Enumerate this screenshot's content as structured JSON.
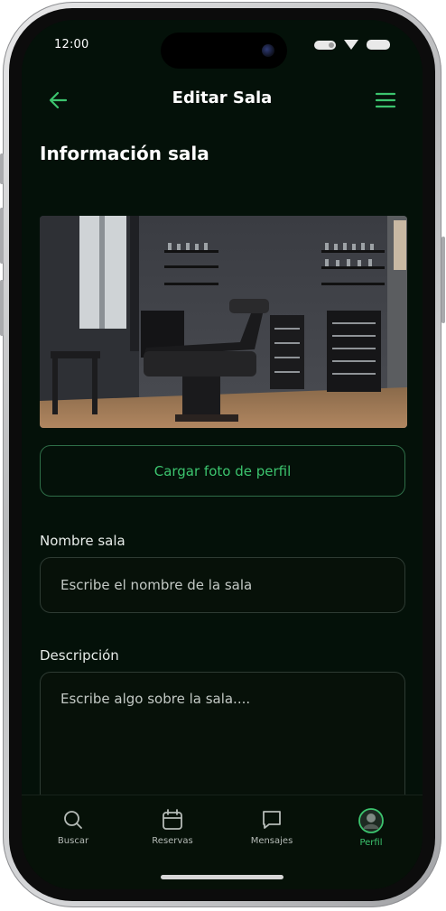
{
  "status_bar": {
    "time": "12:00"
  },
  "header": {
    "title": "Editar Sala",
    "back_icon": "arrow-left-icon",
    "menu_icon": "hamburger-menu-icon"
  },
  "section": {
    "title": "Información sala"
  },
  "photo": {
    "icon": "room-photo"
  },
  "upload": {
    "label": "Cargar foto de perfil"
  },
  "form": {
    "name": {
      "label": "Nombre sala",
      "placeholder": "Escribe el nombre de la sala"
    },
    "description": {
      "label": "Descripción",
      "placeholder": "Escribe algo sobre la sala...."
    }
  },
  "tabbar": {
    "items": [
      {
        "label": "Buscar",
        "icon": "search-icon",
        "active": false
      },
      {
        "label": "Reservas",
        "icon": "calendar-icon",
        "active": false
      },
      {
        "label": "Mensajes",
        "icon": "message-icon",
        "active": false
      },
      {
        "label": "Perfil",
        "icon": "avatar-icon",
        "active": true
      }
    ]
  },
  "colors": {
    "accent": "#3cc46e",
    "background": "#041109",
    "border": "#2f6e48"
  }
}
